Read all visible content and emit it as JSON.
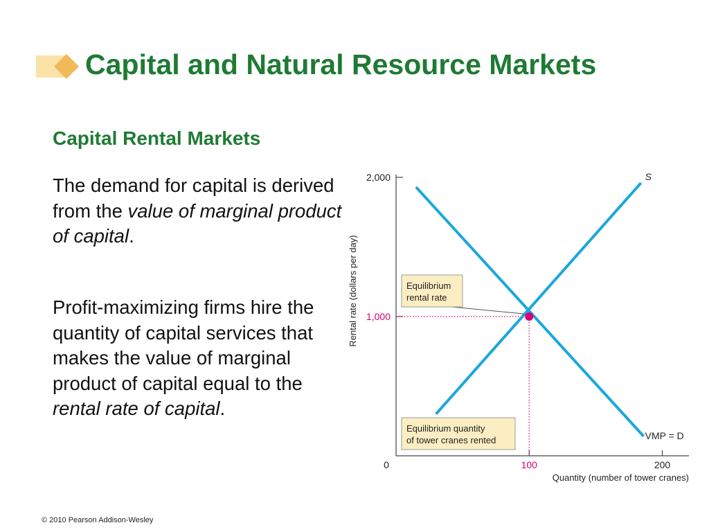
{
  "slide": {
    "title": "Capital and Natural Resource Markets",
    "subtitle": "Capital Rental Markets",
    "para1": {
      "t1": "The demand for capital is derived from the ",
      "em1": "value of marginal product of capital",
      "t2": "."
    },
    "para2": {
      "t1": "Profit-maximizing firms hire the quantity of capital services that makes the value of marginal product of capital equal to the ",
      "em1": "rental rate of capital",
      "t2": "."
    },
    "copyright": "© 2010 Pearson Addison-Wesley"
  },
  "colors": {
    "title": "#1f7a34",
    "curve": "#1aa7dc",
    "equilibrium": "#d6006f",
    "callout_bg": "#fbeec2"
  },
  "chart_data": {
    "type": "line",
    "xlabel": "Quantity (number of tower cranes)",
    "ylabel": "Rental rate (dollars per day)",
    "xlim": [
      0,
      220
    ],
    "ylim": [
      0,
      2000
    ],
    "x_ticks": [
      {
        "value": 0,
        "label": "0"
      },
      {
        "value": 100,
        "label": "100"
      },
      {
        "value": 200,
        "label": "200"
      }
    ],
    "y_ticks": [
      {
        "value": 1000,
        "label": "1,000"
      },
      {
        "value": 2000,
        "label": "2,000"
      }
    ],
    "series": [
      {
        "name": "S",
        "points": [
          [
            30,
            300
          ],
          [
            184,
            1960
          ]
        ]
      },
      {
        "name": "VMP = D",
        "points": [
          [
            15,
            1930
          ],
          [
            186,
            140
          ]
        ]
      }
    ],
    "equilibrium": {
      "x": 100,
      "y": 1000
    },
    "annotations": {
      "rate": [
        "Equilibrium",
        "rental rate"
      ],
      "quantity": [
        "Equilibrium quantity",
        "of tower cranes rented"
      ]
    },
    "grid": false
  }
}
